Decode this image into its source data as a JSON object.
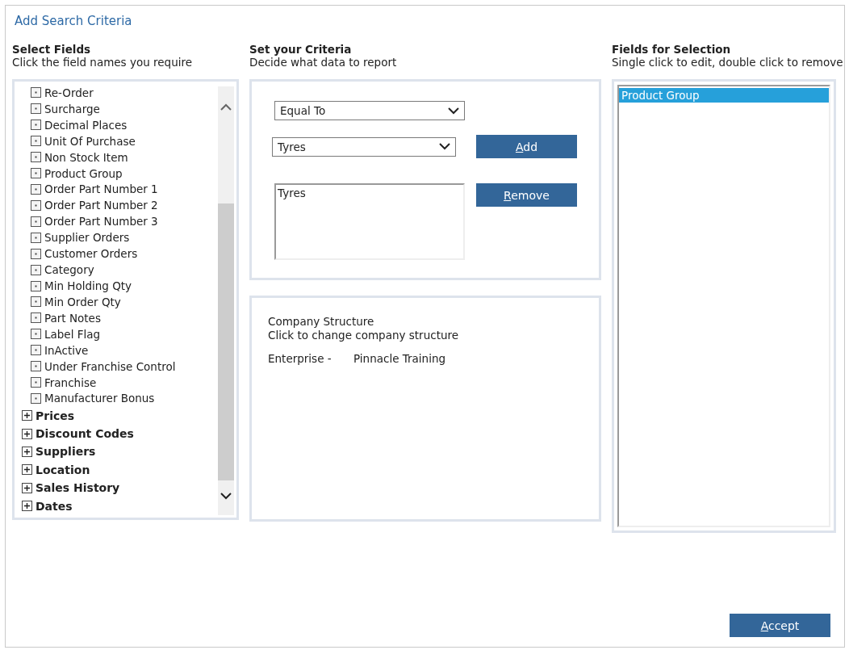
{
  "window": {
    "title": "Add Search Criteria"
  },
  "select_fields": {
    "heading": "Select Fields",
    "hint": "Click the field names you require",
    "items": [
      {
        "kind": "field",
        "label": "Re-Order"
      },
      {
        "kind": "field",
        "label": "Surcharge"
      },
      {
        "kind": "field",
        "label": "Decimal Places"
      },
      {
        "kind": "field",
        "label": "Unit Of Purchase"
      },
      {
        "kind": "field",
        "label": "Non Stock Item"
      },
      {
        "kind": "field",
        "label": "Product Group"
      },
      {
        "kind": "field",
        "label": "Order Part Number 1"
      },
      {
        "kind": "field",
        "label": "Order Part Number 2"
      },
      {
        "kind": "field",
        "label": "Order Part Number 3"
      },
      {
        "kind": "field",
        "label": "Supplier Orders"
      },
      {
        "kind": "field",
        "label": "Customer Orders"
      },
      {
        "kind": "field",
        "label": "Category"
      },
      {
        "kind": "field",
        "label": "Min Holding Qty"
      },
      {
        "kind": "field",
        "label": "Min Order Qty"
      },
      {
        "kind": "field",
        "label": "Part Notes"
      },
      {
        "kind": "field",
        "label": "Label Flag"
      },
      {
        "kind": "field",
        "label": "InActive"
      },
      {
        "kind": "field",
        "label": "Under Franchise Control"
      },
      {
        "kind": "field",
        "label": "Franchise"
      },
      {
        "kind": "field",
        "label": "Manufacturer Bonus"
      },
      {
        "kind": "group",
        "label": "Prices",
        "expanded": false
      },
      {
        "kind": "group",
        "label": "Discount Codes",
        "expanded": false
      },
      {
        "kind": "group",
        "label": "Suppliers",
        "expanded": false
      },
      {
        "kind": "group",
        "label": "Location",
        "expanded": false
      },
      {
        "kind": "group",
        "label": "Sales History",
        "expanded": false
      },
      {
        "kind": "group",
        "label": "Dates",
        "expanded": false
      }
    ]
  },
  "criteria": {
    "heading": "Set your Criteria",
    "hint": "Decide what data to report",
    "operator": {
      "value": "Equal To"
    },
    "value_select": {
      "value": "Tyres"
    },
    "values_list": [
      "Tyres"
    ],
    "buttons": [
      {
        "label": "Add",
        "mnemonic": true
      },
      {
        "label": "Remove",
        "mnemonic": true
      }
    ]
  },
  "company": {
    "title": "Company Structure",
    "hint": "Click to change company structure",
    "label": "Enterprise -",
    "value": "Pinnacle Training"
  },
  "selection": {
    "heading": "Fields for Selection",
    "hint": "Single click to edit, double click to remove",
    "items": [
      {
        "label": "Product Group",
        "selected": true
      }
    ]
  },
  "footer": {
    "button": {
      "label": "Accept",
      "mnemonic": true
    }
  }
}
